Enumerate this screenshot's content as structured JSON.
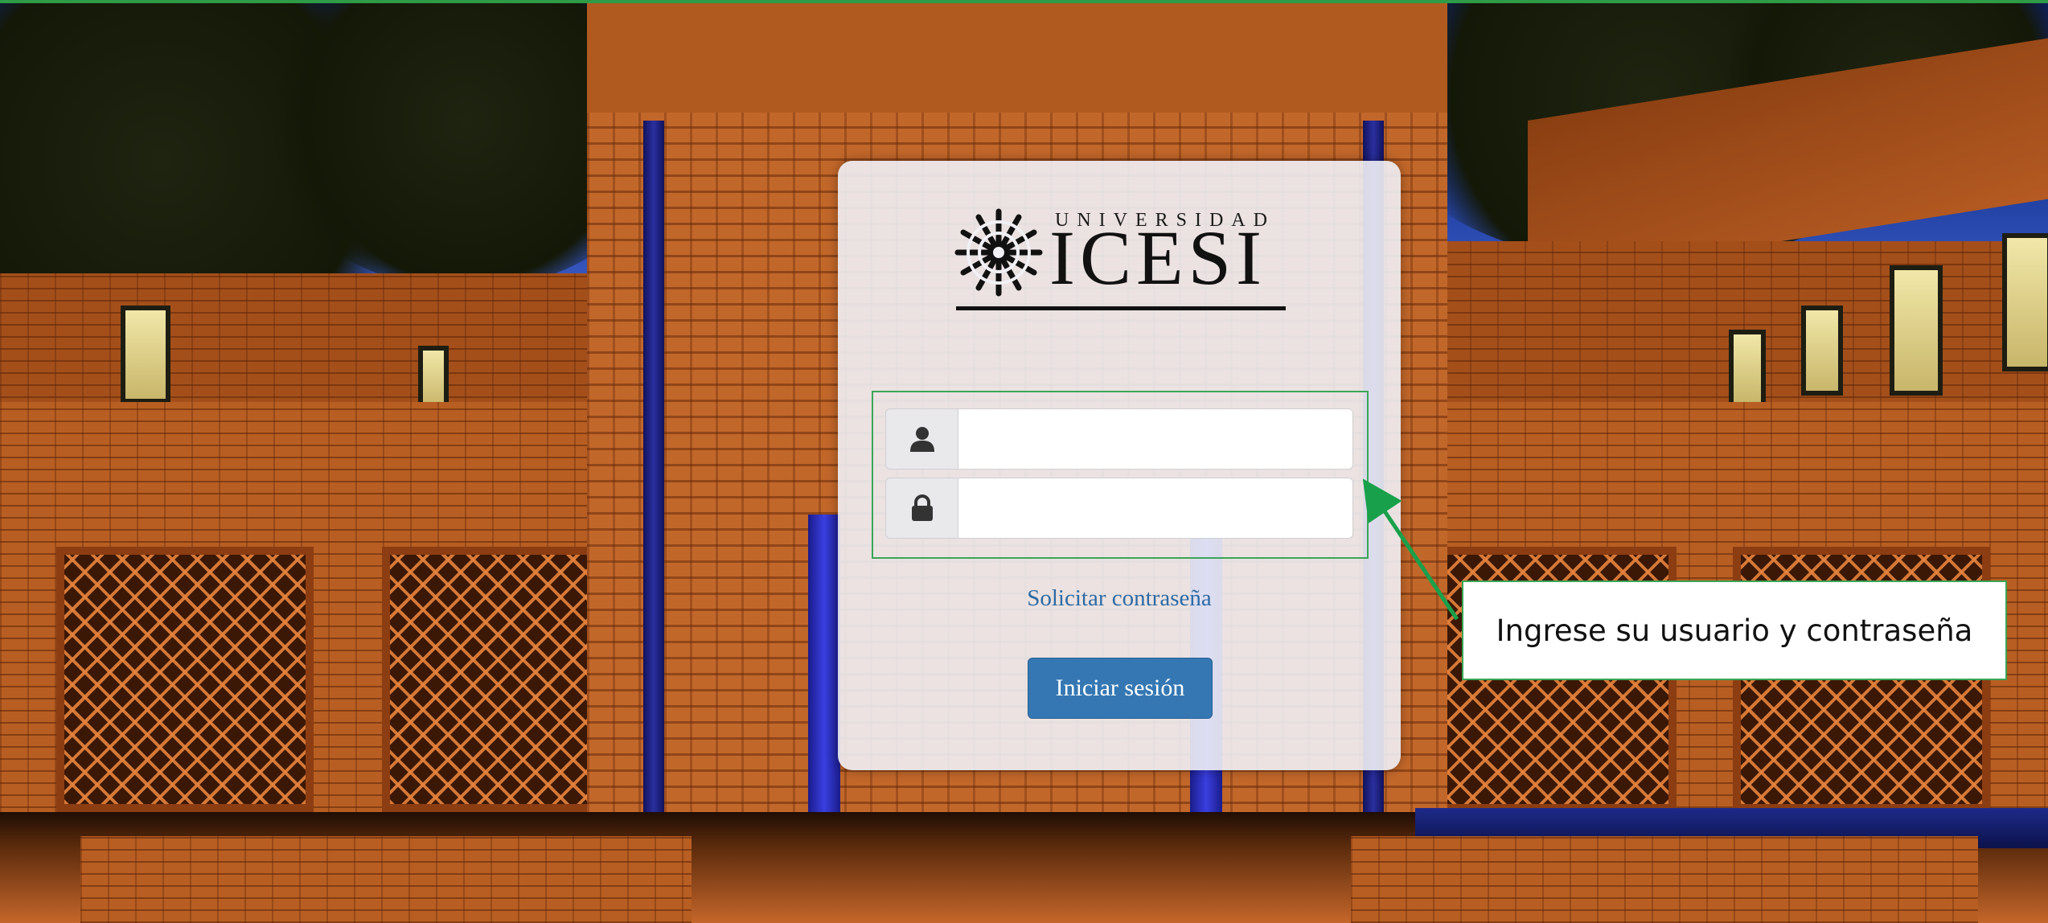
{
  "logo": {
    "small_text": "UNIVERSIDAD",
    "big_text": "ICESI"
  },
  "form": {
    "username_icon": "user-icon",
    "password_icon": "lock-icon",
    "username_value": "",
    "password_value": ""
  },
  "links": {
    "forgot_password": "Solicitar contraseña"
  },
  "buttons": {
    "login": "Iniciar sesión"
  },
  "annotation": {
    "callout_text": "Ingrese su usuario y contraseña",
    "highlight_color": "#3aa557"
  },
  "colors": {
    "link": "#2d6aa4",
    "button": "#3477b3",
    "card_background": "#f0f0f5"
  }
}
